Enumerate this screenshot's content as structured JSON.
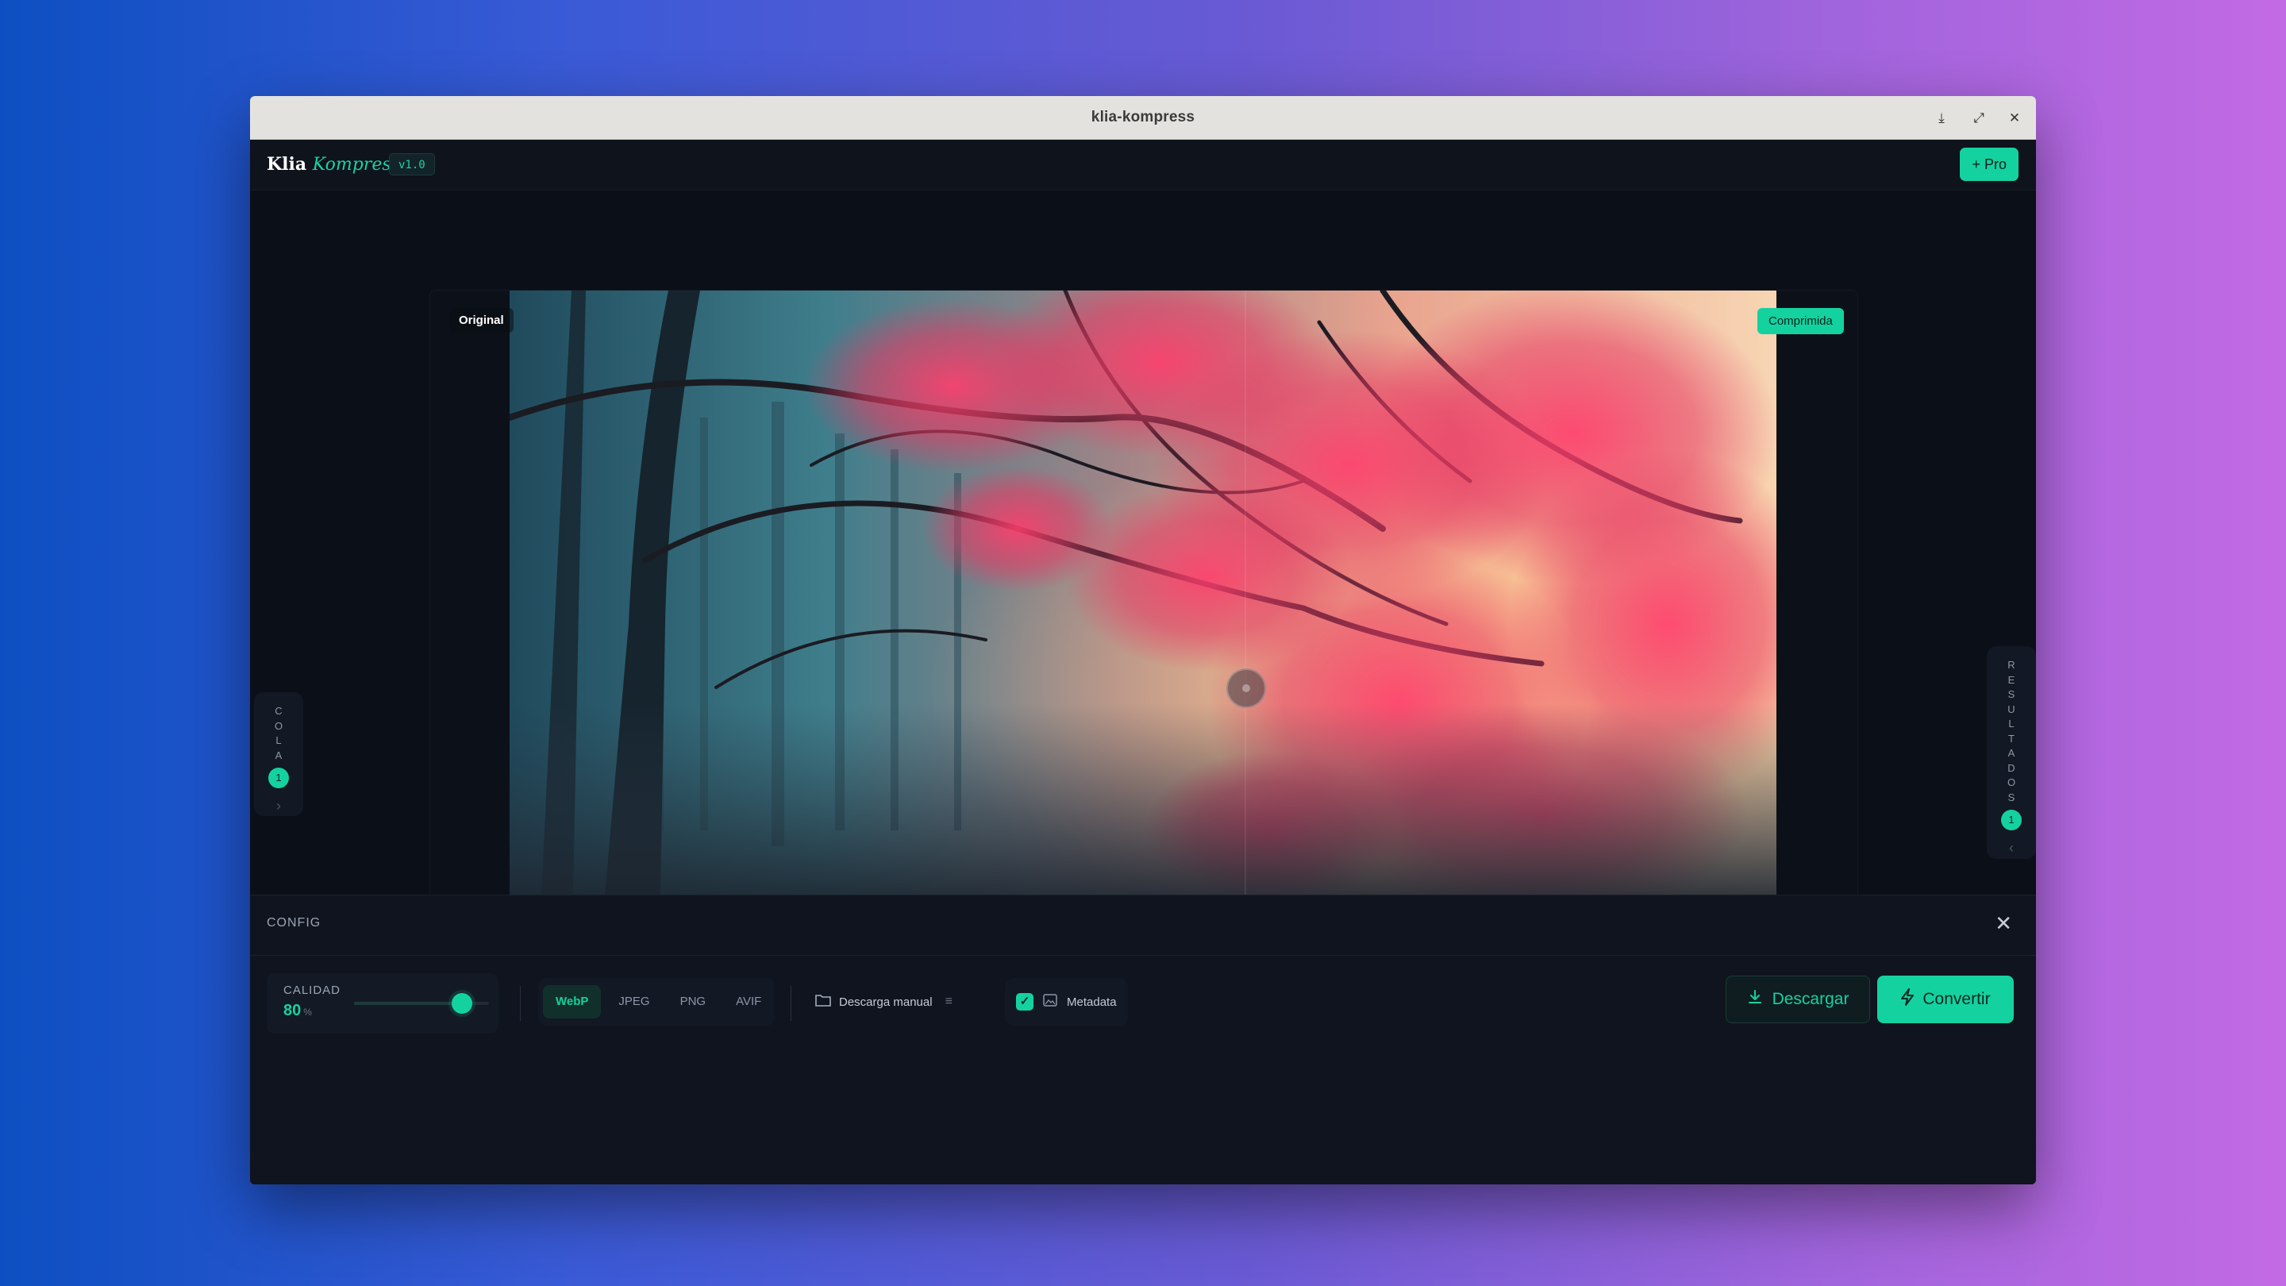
{
  "window": {
    "title": "klia-kompress",
    "controls": {
      "minimize": "⤓",
      "maximize": "⤢",
      "close": "✕"
    }
  },
  "app": {
    "logo_main": "Klia",
    "logo_accent": "Kompress",
    "version": "v1.0",
    "pro_label": "+ Pro"
  },
  "preview": {
    "original_label": "Original",
    "compressed_label": "Comprimida",
    "compare_split": 0.64
  },
  "queue_tab": {
    "letters": [
      "C",
      "O",
      "L",
      "A"
    ],
    "count": "1",
    "chevron": "›"
  },
  "results_tab": {
    "letters": [
      "R",
      "E",
      "S",
      "U",
      "L",
      "T",
      "A",
      "D",
      "O",
      "S"
    ],
    "count": "1",
    "chevron": "‹"
  },
  "config": {
    "title": "CONFIG",
    "close_icon": "✕",
    "quality": {
      "label": "CALIDAD",
      "value": "80",
      "unit": "%",
      "fraction": 0.8
    },
    "formats": [
      {
        "label": "WebP",
        "active": true
      },
      {
        "label": "JPEG",
        "active": false
      },
      {
        "label": "PNG",
        "active": false
      },
      {
        "label": "AVIF",
        "active": false
      }
    ],
    "download_mode": {
      "label": "Descarga manual",
      "icon": "folder-icon",
      "menu_icon": "≡"
    },
    "metadata": {
      "label": "Metadata",
      "checked": true,
      "check": "✓"
    },
    "download_button": "Descargar",
    "convert_button": "Convertir"
  },
  "colors": {
    "accent": "#14d2a0",
    "background": "#0b0f17",
    "panel": "#0f141e"
  }
}
